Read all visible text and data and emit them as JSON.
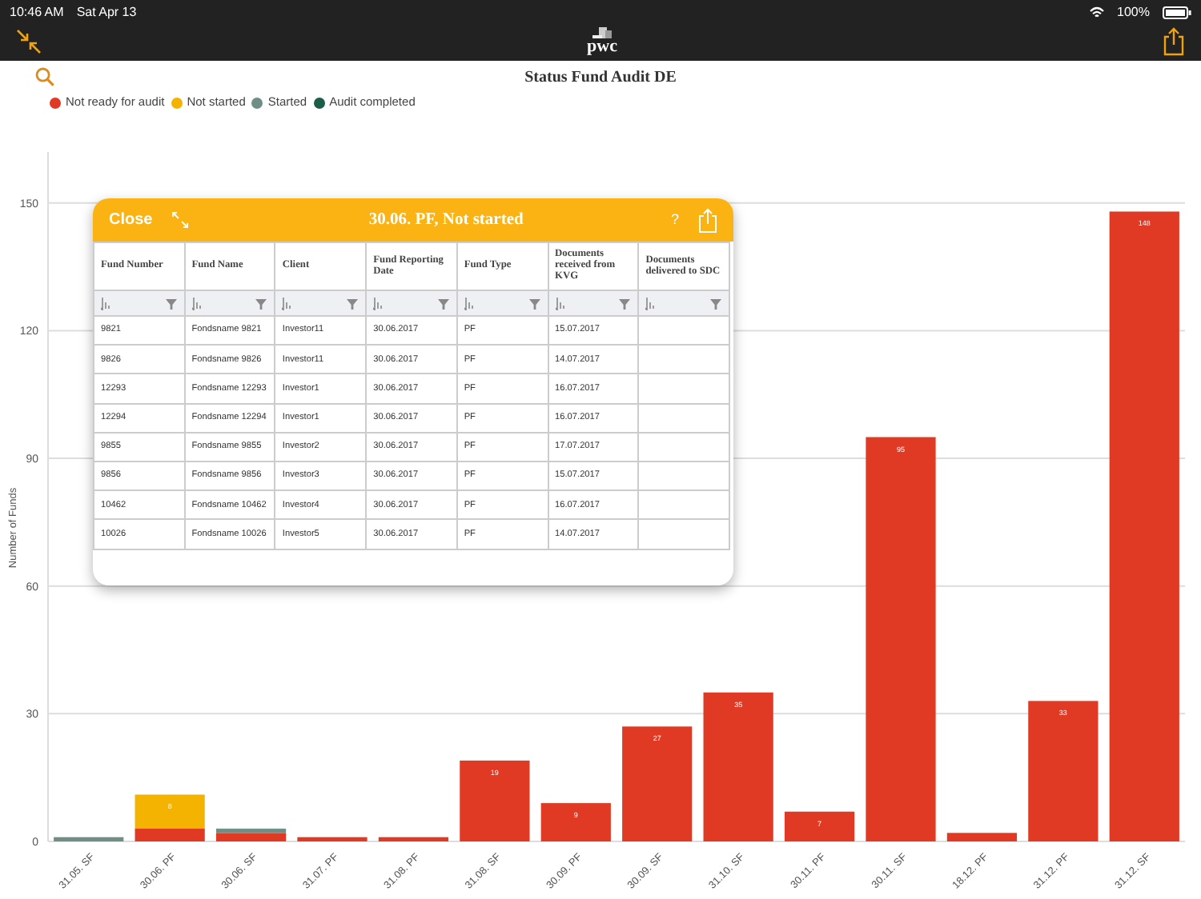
{
  "status_bar": {
    "time": "10:46 AM",
    "date": "Sat Apr 13",
    "battery": "100%"
  },
  "nav_bar": {
    "logo": "pwc"
  },
  "chart": {
    "title": "Status Fund Audit DE",
    "chart_data": {
      "type": "bar",
      "stacked": true,
      "orientation": "vertical",
      "ylabel": "Number of Funds",
      "categories": [
        "31.05. SF",
        "30.06. PF",
        "30.06. SF",
        "31.07. PF",
        "31.08. PF",
        "31.08. SF",
        "30.09. PF",
        "30.09. SF",
        "31.10. SF",
        "30.11. PF",
        "30.11. SF",
        "18.12. PF",
        "31.12. PF",
        "31.12. SF"
      ],
      "series": [
        {
          "name": "Not ready for audit",
          "color": "#e03a24",
          "values": [
            null,
            3,
            2,
            1,
            1,
            19,
            9,
            27,
            35,
            7,
            95,
            2,
            33,
            148
          ],
          "value_labels": [
            null,
            null,
            null,
            null,
            null,
            "19",
            "9",
            "27",
            "35",
            "7",
            "95",
            null,
            "33",
            "148"
          ]
        },
        {
          "name": "Not started",
          "color": "#f5b301",
          "values": [
            null,
            8,
            null,
            null,
            null,
            null,
            null,
            null,
            null,
            null,
            null,
            null,
            null,
            null
          ],
          "value_labels": [
            null,
            "8",
            null,
            null,
            null,
            null,
            null,
            null,
            null,
            null,
            null,
            null,
            null,
            null
          ]
        },
        {
          "name": "Started",
          "color": "#6f8f86",
          "values": [
            1,
            null,
            1,
            null,
            null,
            null,
            null,
            null,
            null,
            null,
            null,
            null,
            null,
            null
          ]
        },
        {
          "name": "Audit completed",
          "color": "#1a5e4a",
          "values": [
            null,
            null,
            null,
            null,
            null,
            null,
            null,
            null,
            null,
            null,
            null,
            null,
            null,
            null
          ]
        }
      ],
      "ylim": [
        0,
        162
      ],
      "yticks": [
        0,
        30,
        60,
        90,
        120,
        150
      ],
      "grid": true
    }
  },
  "popup": {
    "close": "Close",
    "title": "30.06. PF, Not started",
    "help": "?",
    "columns": [
      "Fund Number",
      "Fund Name",
      "Client",
      "Fund Reporting Date",
      "Fund Type",
      "Documents received from KVG",
      "Documents delivered to SDC"
    ],
    "rows": [
      [
        "9821",
        "Fondsname 9821",
        "Investor11",
        "30.06.2017",
        "PF",
        "15.07.2017",
        ""
      ],
      [
        "9826",
        "Fondsname 9826",
        "Investor11",
        "30.06.2017",
        "PF",
        "14.07.2017",
        ""
      ],
      [
        "12293",
        "Fondsname 12293",
        "Investor1",
        "30.06.2017",
        "PF",
        "16.07.2017",
        ""
      ],
      [
        "12294",
        "Fondsname 12294",
        "Investor1",
        "30.06.2017",
        "PF",
        "16.07.2017",
        ""
      ],
      [
        "9855",
        "Fondsname 9855",
        "Investor2",
        "30.06.2017",
        "PF",
        "17.07.2017",
        ""
      ],
      [
        "9856",
        "Fondsname 9856",
        "Investor3",
        "30.06.2017",
        "PF",
        "15.07.2017",
        ""
      ],
      [
        "10462",
        "Fondsname 10462",
        "Investor4",
        "30.06.2017",
        "PF",
        "16.07.2017",
        ""
      ],
      [
        "10026",
        "Fondsname 10026",
        "Investor5",
        "30.06.2017",
        "PF",
        "14.07.2017",
        ""
      ]
    ]
  }
}
